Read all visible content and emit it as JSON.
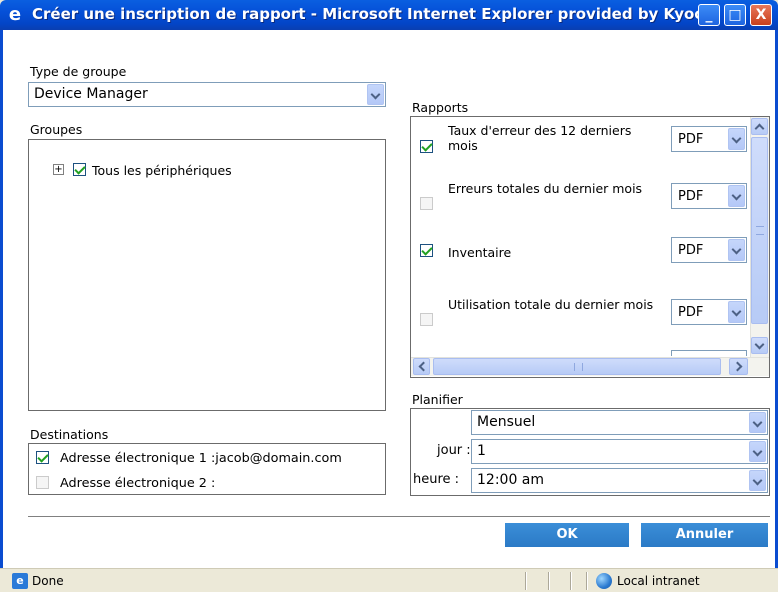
{
  "window": {
    "title": "Créer une inscription de rapport - Microsoft Internet Explorer provided by Kyoc...",
    "icon": "ie-icon",
    "minimize": "_",
    "maximize": "□",
    "close": "X"
  },
  "group_type": {
    "label": "Type de groupe",
    "value": "Device Manager"
  },
  "groups": {
    "label": "Groupes",
    "expand": "⊞",
    "tree_item": "Tous les périphériques",
    "tree_item_checked": true
  },
  "destinations": {
    "label": "Destinations",
    "items": [
      {
        "label": "Adresse électronique 1 :jacob@domain.com",
        "checked": true
      },
      {
        "label": "Adresse électronique 2 :",
        "checked": false
      }
    ]
  },
  "reports": {
    "label": "Rapports",
    "items": [
      {
        "name": "Taux d'erreur des 12 derniers mois",
        "checked": true,
        "format": "PDF"
      },
      {
        "name": "Erreurs totales du dernier mois",
        "checked": false,
        "format": "PDF"
      },
      {
        "name": "Inventaire",
        "checked": true,
        "format": "PDF"
      },
      {
        "name": "Utilisation totale du dernier mois",
        "checked": false,
        "format": "PDF"
      }
    ]
  },
  "schedule": {
    "label": "Planifier",
    "frequency": "Mensuel",
    "day_label": "jour :",
    "day_value": "1",
    "hour_label": "heure :",
    "hour_value": "12:00 am"
  },
  "buttons": {
    "ok": "OK",
    "cancel": "Annuler"
  },
  "status": {
    "text": "Done",
    "zone": "Local intranet"
  },
  "colors": {
    "title_bar": "#0550d8",
    "button": "#2b7ac6",
    "check": "#21a121"
  }
}
